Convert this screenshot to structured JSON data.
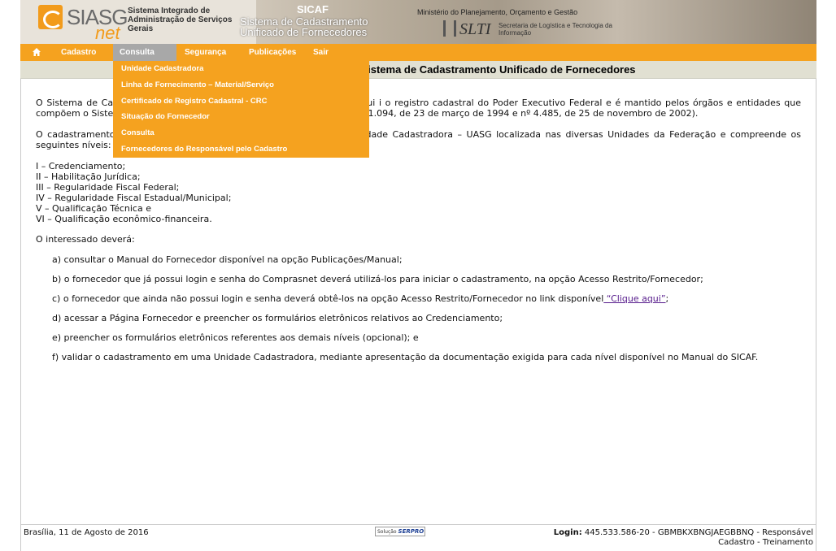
{
  "header": {
    "logo_main": "SIASG",
    "logo_sub": "net",
    "system_name": "Sistema Integrado de Administração de Serviços Gerais",
    "sicaf_title": "SICAF",
    "sicaf_subtitle": "Sistema de Cadastramento Unificado de Fornecedores",
    "ministry": "Ministério do Planejamento, Orçamento e Gestão",
    "slti_logo": "SLTI",
    "slti_text": "Secretaria de Logística e Tecnologia da Informação"
  },
  "menu": {
    "home_icon": "home-icon",
    "items": [
      {
        "label": "Cadastro"
      },
      {
        "label": "Consulta"
      },
      {
        "label": "Segurança"
      },
      {
        "label": "Publicações"
      },
      {
        "label": "Sair"
      }
    ],
    "dropdown": [
      {
        "label": "Unidade Cadastradora"
      },
      {
        "label": "Linha de Fornecimento – Material/Serviço"
      },
      {
        "label": "Certificado de Registro Cadastral - CRC"
      },
      {
        "label": "Situação do Fornecedor"
      },
      {
        "label": "Consulta"
      },
      {
        "label": "Fornecedores do Responsável pelo Cadastro"
      }
    ]
  },
  "page_title": "Sistema de Cadastramento Unificado de Fornecedores",
  "content": {
    "para1": "O Sistema de Cadastramento Unificado de Fornecedores – SICAF constitui i o registro cadastral do Poder Executivo Federal e é mantido pelos órgãos e entidades que compõem o Sistema de Serviços Gerais – SISG, nos termos do Decreto nº 1.094, de 23 de março de 1994 e nº 4.485, de 25 de novembro de 2002).",
    "para2": "O cadastramento do fornecedor poderá ser realizado em qualquer Unidade Cadastradora – UASG localizada nas diversas Unidades da Federação e compreende os seguintes níveis:",
    "levels": [
      "I – Credenciamento;",
      "II – Habilitação Jurídica;",
      "III – Regularidade Fiscal Federal;",
      "IV – Regularidade Fiscal Estadual/Municipal;",
      "V – Qualificação Técnica e",
      "VI – Qualificação econômico-financeira."
    ],
    "interested": "O interessado deverá:",
    "step_a": "a) consultar o Manual do Fornecedor disponível na opção Publicações/Manual;",
    "step_b": "b) o fornecedor que já possui login e senha do Comprasnet deverá utilizá-los para iniciar o cadastramento, na opção Acesso Restrito/Fornecedor;",
    "step_c": "c) o fornecedor que ainda não possui login e senha deverá obtê-los na opção Acesso Restrito/Fornecedor no link disponível",
    "step_c_link": " “Clique aqui”",
    "step_c_end": ";",
    "step_d": "d) acessar a Página Fornecedor e preencher os formulários eletrônicos relativos ao Credenciamento;",
    "step_e": "e) preencher os formulários eletrônicos referentes aos demais níveis (opcional); e",
    "step_f": "f) validar o cadastramento em uma Unidade Cadastradora, mediante apresentação da documentação exigida para cada nível disponível no Manual do SICAF."
  },
  "footer": {
    "date": "Brasília, 11 de Agosto de 2016",
    "serpro_prefix": "Solução",
    "serpro_name": "SERPRO",
    "login_label": "Login:",
    "login_value": " 445.533.586-20 - GBMBKXBNGJAEGBBNQ - Responsável Cadastro - Treinamento"
  }
}
